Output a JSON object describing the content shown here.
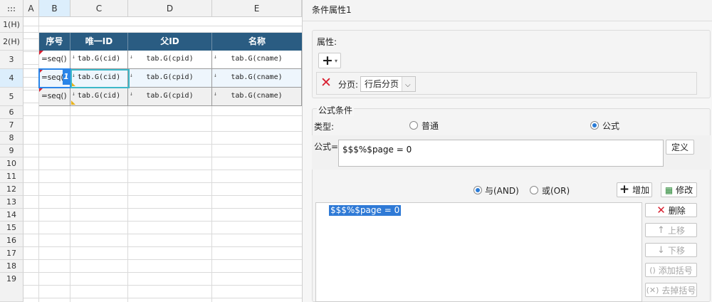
{
  "sheet": {
    "columns": [
      "A",
      "B",
      "C",
      "D",
      "E"
    ],
    "rows": [
      "1(H)",
      "2(H)",
      "3",
      "4",
      "5",
      "6",
      "7",
      "8",
      "9",
      "10",
      "11",
      "12",
      "13",
      "14",
      "15",
      "16",
      "17",
      "18",
      "19"
    ],
    "header_cells": [
      "序号",
      "唯一ID",
      "父ID",
      "名称"
    ],
    "data_rows": [
      [
        "=seq()",
        "tab.G(cid)",
        "tab.G(cpid)",
        "tab.G(cname)"
      ],
      [
        "=seq(",
        "tab.G(cid)",
        "tab.G(cpid)",
        "tab.G(cname)"
      ],
      [
        "=seq()",
        "tab.G(cid)",
        "tab.G(cpid)",
        "tab.G(cname)"
      ]
    ],
    "selection_badge": "1"
  },
  "panel": {
    "title": "条件属性1",
    "properties_label": "属性:",
    "add_icon": "plus-icon",
    "delete_icon": "red-x-icon",
    "page_label": "分页:",
    "page_value": "行后分页",
    "formula_condition_label": "公式条件",
    "type_label": "类型:",
    "type_options": [
      "普通",
      "公式"
    ],
    "type_selected": "公式",
    "formula_label": "公式=",
    "formula_value": "$$$%$page = 0",
    "define_button": "定义",
    "logic_options": [
      "与(AND)",
      "或(OR)"
    ],
    "logic_selected": "与(AND)",
    "add_button": "增加",
    "modify_button": "修改",
    "conditions": [
      "$$$%$page = 0"
    ],
    "side_buttons": [
      "删除",
      "上移",
      "下移",
      "添加括号",
      "去掉括号"
    ]
  },
  "colors": {
    "header_blue": "#2a5c82",
    "selection_blue": "#2a85e8",
    "list_highlight": "#2f7ad6",
    "delete_red": "#d82030"
  }
}
